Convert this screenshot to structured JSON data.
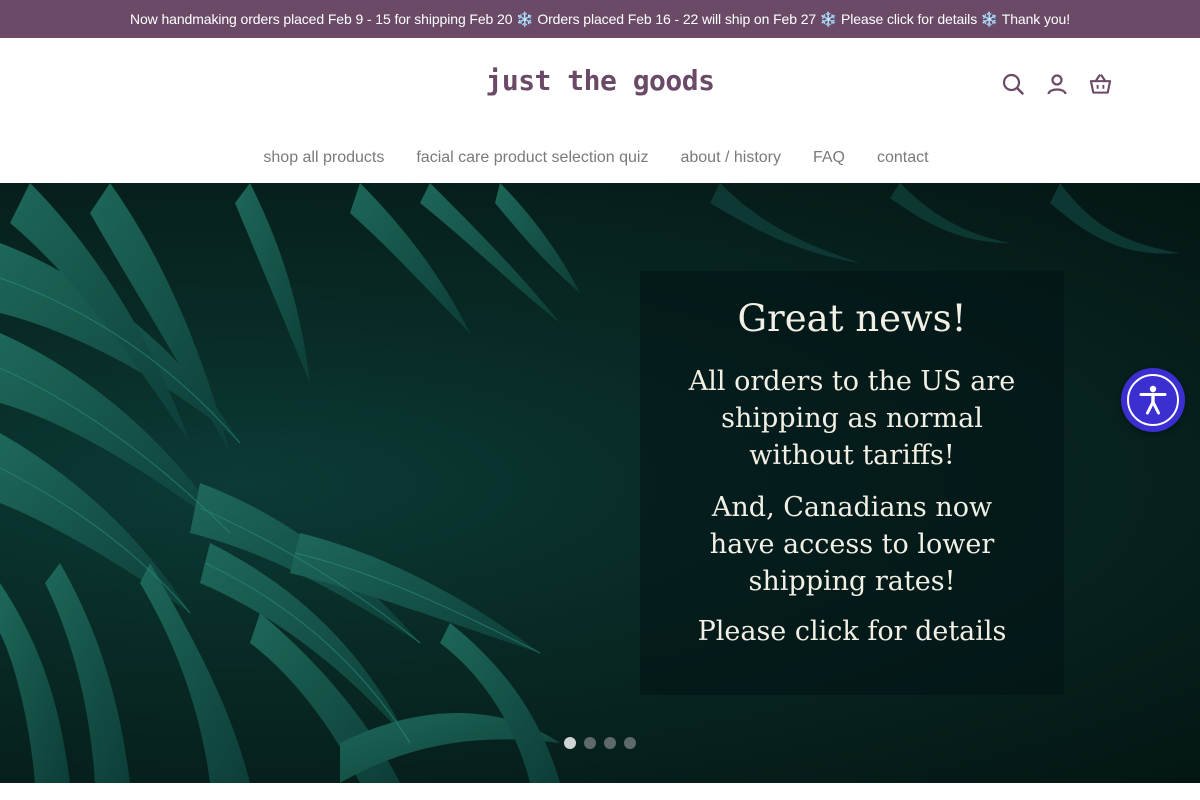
{
  "announcement": {
    "text": "Now handmaking orders placed Feb 9 - 15 for shipping Feb 20 ❄️ Orders placed Feb 16 - 22 will ship on Feb 27 ❄️ Please click for details ❄️ Thank you!",
    "background": "#6a4a66"
  },
  "header": {
    "logo_text": "just the goods",
    "brand_color": "#6a4a66",
    "icons": [
      "search-icon",
      "account-icon",
      "cart-icon"
    ]
  },
  "nav": {
    "items": [
      {
        "label": "shop all products"
      },
      {
        "label": "facial care product selection quiz"
      },
      {
        "label": "about / history"
      },
      {
        "label": "FAQ"
      },
      {
        "label": "contact"
      }
    ]
  },
  "hero": {
    "title": "Great news!",
    "line1": "All orders to the US are shipping as normal without tariffs!",
    "line2": "And, Canadians now have access to lower shipping rates!",
    "line3": "Please click for details",
    "slide_count": 4,
    "active_slide": 1
  },
  "accessibility": {
    "icon": "accessibility-icon",
    "color": "#3b2fd1"
  }
}
